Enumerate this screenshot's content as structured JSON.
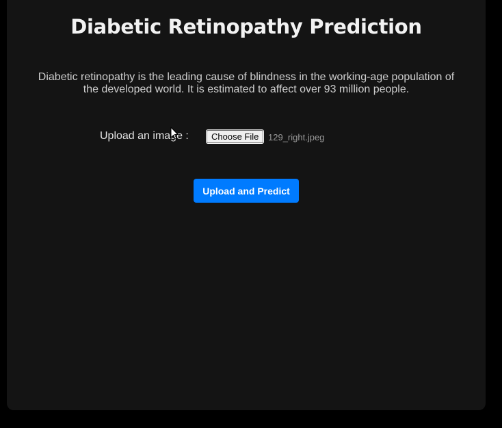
{
  "page": {
    "title": "Diabetic Retinopathy Prediction",
    "description": "Diabetic retinopathy is the leading cause of blindness in the working-age population of the developed world. It is estimated to affect over 93 million people."
  },
  "upload": {
    "label": "Upload an image :",
    "choose_button_label": "Choose File",
    "selected_file": "129_right.jpeg"
  },
  "actions": {
    "predict_label": "Upload and Predict"
  },
  "colors": {
    "background": "#000000",
    "card": "#141414",
    "accent": "#007bff"
  },
  "icons": {
    "cursor": "mouse-pointer-icon"
  }
}
